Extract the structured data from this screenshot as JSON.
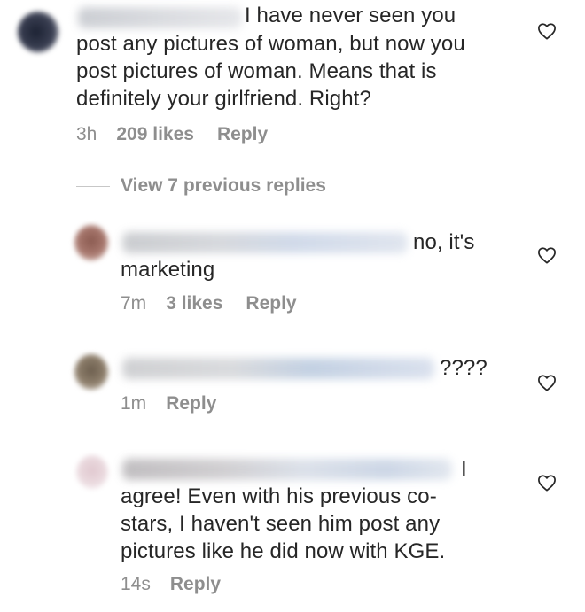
{
  "comments": [
    {
      "text_lines": [
        "I have never seen you",
        "post any pictures of woman, but now you",
        "post pictures of woman. Means that is",
        "definitely your girlfriend. Right?"
      ],
      "time": "3h",
      "likes": "209 likes",
      "reply_label": "Reply"
    },
    {
      "text_lines": [
        "no, it's",
        "marketing"
      ],
      "time": "7m",
      "likes": "3 likes",
      "reply_label": "Reply"
    },
    {
      "text_lines": [
        "????"
      ],
      "time": "1m",
      "reply_label": "Reply"
    },
    {
      "text_lines": [
        "I",
        "agree! Even with his previous co-",
        "stars, I haven't seen him post any",
        "pictures like he did now with KGE."
      ],
      "time": "14s",
      "reply_label": "Reply"
    }
  ],
  "view_replies": "View 7 previous replies",
  "icons": {
    "like": "heart-outline-icon"
  },
  "colors": {
    "text": "#262626",
    "meta": "#8e8e8e",
    "heart_stroke": "#262626"
  }
}
